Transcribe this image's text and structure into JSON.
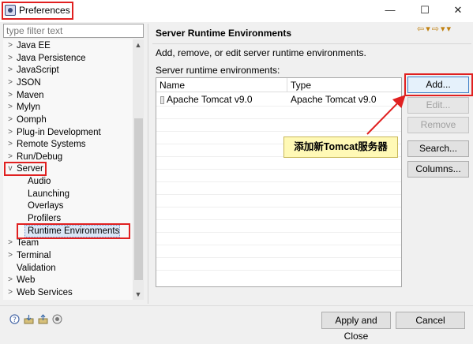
{
  "window": {
    "title": "Preferences",
    "controls": {
      "minimize": "—",
      "maximize": "☐",
      "close": "✕"
    }
  },
  "filter": {
    "placeholder": "type filter text"
  },
  "tree": {
    "items": [
      {
        "label": "Java EE",
        "level": 0,
        "expanded": false
      },
      {
        "label": "Java Persistence",
        "level": 0,
        "expanded": false
      },
      {
        "label": "JavaScript",
        "level": 0,
        "expanded": false
      },
      {
        "label": "JSON",
        "level": 0,
        "expanded": false
      },
      {
        "label": "Maven",
        "level": 0,
        "expanded": false
      },
      {
        "label": "Mylyn",
        "level": 0,
        "expanded": false
      },
      {
        "label": "Oomph",
        "level": 0,
        "expanded": false
      },
      {
        "label": "Plug-in Development",
        "level": 0,
        "expanded": false
      },
      {
        "label": "Remote Systems",
        "level": 0,
        "expanded": false
      },
      {
        "label": "Run/Debug",
        "level": 0,
        "expanded": false
      },
      {
        "label": "Server",
        "level": 0,
        "expanded": true
      },
      {
        "label": "Audio",
        "level": 1
      },
      {
        "label": "Launching",
        "level": 1
      },
      {
        "label": "Overlays",
        "level": 1
      },
      {
        "label": "Profilers",
        "level": 1
      },
      {
        "label": "Runtime Environments",
        "level": 1,
        "selected": true
      },
      {
        "label": "Team",
        "level": 0,
        "expanded": false
      },
      {
        "label": "Terminal",
        "level": 0,
        "expanded": false
      },
      {
        "label": "Validation",
        "level": 0,
        "leaf": true
      },
      {
        "label": "Web",
        "level": 0,
        "expanded": false
      },
      {
        "label": "Web Services",
        "level": 0,
        "expanded": false
      }
    ]
  },
  "page": {
    "title": "Server Runtime Environments",
    "description": "Add, remove, or edit server runtime environments.",
    "list_label": "Server runtime environments:",
    "table": {
      "columns": [
        "Name",
        "Type"
      ],
      "rows": [
        {
          "name": "Apache Tomcat v9.0",
          "type": "Apache Tomcat v9.0"
        }
      ]
    },
    "buttons": {
      "add": "Add...",
      "edit": "Edit...",
      "remove": "Remove",
      "search": "Search...",
      "columns": "Columns..."
    }
  },
  "annotation": {
    "callout": "添加新Tomcat服务器",
    "highlight_color": "#e02020",
    "callout_color": "#fff9b6"
  },
  "footer": {
    "apply_close": "Apply and Close",
    "cancel": "Cancel"
  },
  "icons": [
    "help-icon",
    "import-icon",
    "export-icon",
    "oomph-icon"
  ]
}
